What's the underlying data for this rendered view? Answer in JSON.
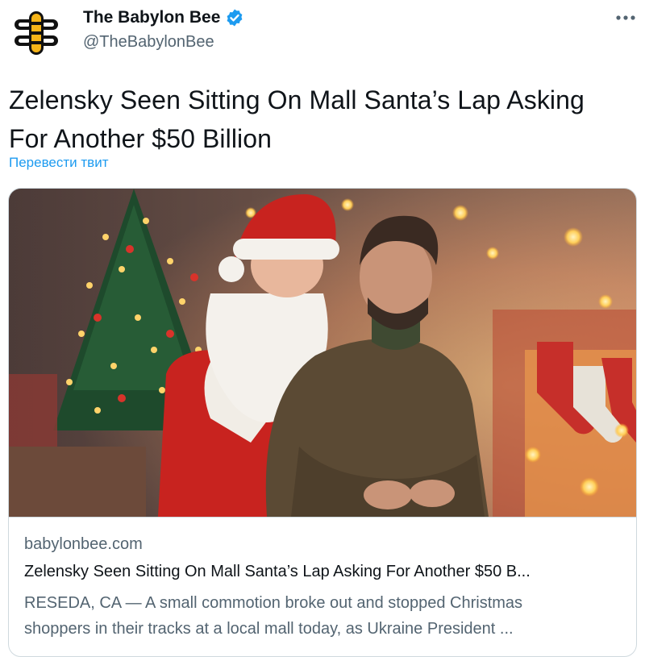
{
  "account": {
    "display_name": "The Babylon Bee",
    "handle": "@TheBabylonBee",
    "verified": true,
    "avatar_icon": "bee-logo-icon",
    "brand_color": "#f6b418"
  },
  "tweet": {
    "text_line_1": "Zelensky Seen Sitting On Mall Santa’s Lap Asking",
    "text_line_2": "For Another $50 Billion",
    "translate_label": "Перевести твит"
  },
  "more_icon": "more-options-icon",
  "card": {
    "domain": "babylonbee.com",
    "title": "Zelensky Seen Sitting On Mall Santa’s Lap Asking For Another $50 B...",
    "description_line_1": "RESEDA, CA — A small commotion broke out and stopped Christmas",
    "description_line_2": "shoppers in their tracks at a local mall today, as Ukraine President ..."
  },
  "colors": {
    "link_blue": "#1d9bf0",
    "secondary_text": "#536471",
    "primary_text": "#0f1419"
  }
}
